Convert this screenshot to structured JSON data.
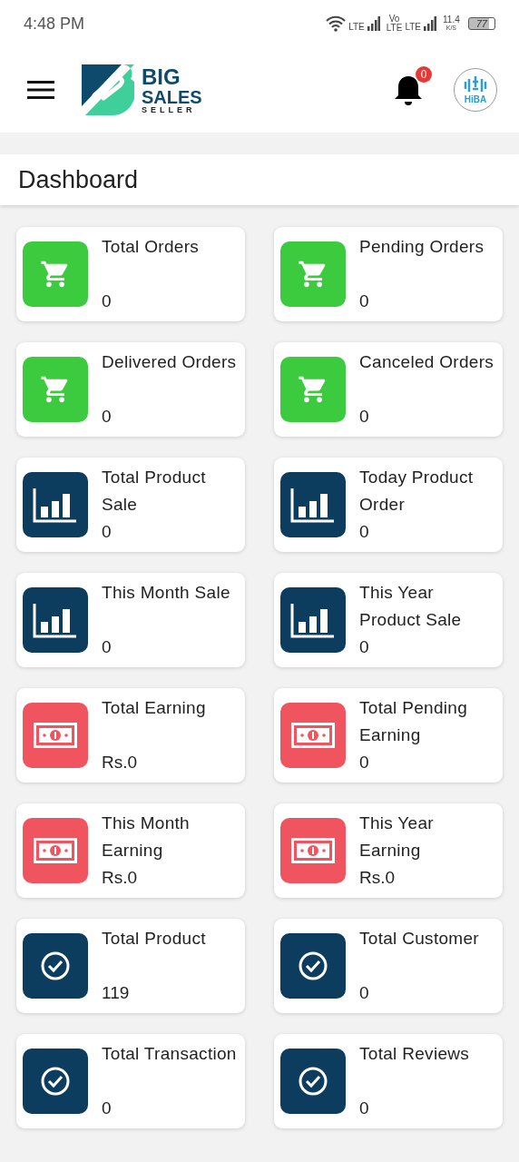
{
  "status_bar": {
    "time": "4:48 PM",
    "network_1": "LTE",
    "volte": [
      "Vo",
      "LTE"
    ],
    "network_2": "LTE",
    "speed": [
      "11.4",
      "K/S"
    ],
    "battery": "77"
  },
  "app_bar": {
    "logo": {
      "line_1": "BIG",
      "line_2": "SALES",
      "line_3": "SELLER"
    },
    "notification_count": "0",
    "avatar_text": "HiBA"
  },
  "page_title": "Dashboard",
  "cards": [
    {
      "kind": "cart",
      "title": "Total Orders",
      "value": "0"
    },
    {
      "kind": "cart",
      "title": "Pending Orders",
      "value": "0"
    },
    {
      "kind": "cart",
      "title": "Delivered Orders",
      "value": "0"
    },
    {
      "kind": "cart",
      "title": "Canceled Orders",
      "value": "0"
    },
    {
      "kind": "chart",
      "title": "Total Product Sale",
      "value": "0"
    },
    {
      "kind": "chart",
      "title": "Today Product Order",
      "value": "0"
    },
    {
      "kind": "chart",
      "title": "This Month Sale",
      "value": "0"
    },
    {
      "kind": "chart",
      "title": "This Year Product Sale",
      "value": "0"
    },
    {
      "kind": "money",
      "title": "Total Earning",
      "value": "Rs.0"
    },
    {
      "kind": "money",
      "title": "Total Pending Earning",
      "value": "0"
    },
    {
      "kind": "money",
      "title": "This Month Earning",
      "value": "Rs.0"
    },
    {
      "kind": "money",
      "title": "This Year Earning",
      "value": "Rs.0"
    },
    {
      "kind": "check",
      "title": "Total Product",
      "value": "119"
    },
    {
      "kind": "check",
      "title": "Total Customer",
      "value": "0"
    },
    {
      "kind": "check",
      "title": "Total Transaction",
      "value": "0"
    },
    {
      "kind": "check",
      "title": "Total Reviews",
      "value": "0"
    }
  ]
}
